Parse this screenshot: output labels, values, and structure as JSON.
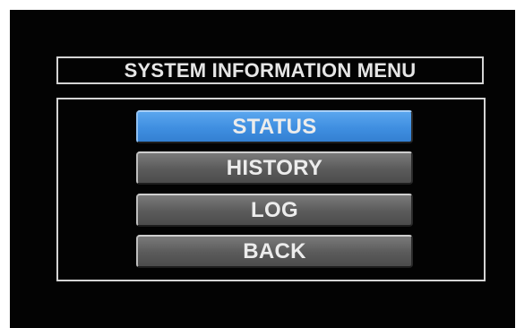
{
  "menu": {
    "title": "SYSTEM INFORMATION MENU",
    "items": [
      {
        "label": "STATUS",
        "selected": true
      },
      {
        "label": "HISTORY",
        "selected": false
      },
      {
        "label": "LOG",
        "selected": false
      },
      {
        "label": "BACK",
        "selected": false
      }
    ]
  },
  "colors": {
    "background": "#030303",
    "frame": "#d4d4d4",
    "button_selected": "#3f8ee0",
    "button_normal": "#5a5a5a",
    "text": "#ececec"
  }
}
